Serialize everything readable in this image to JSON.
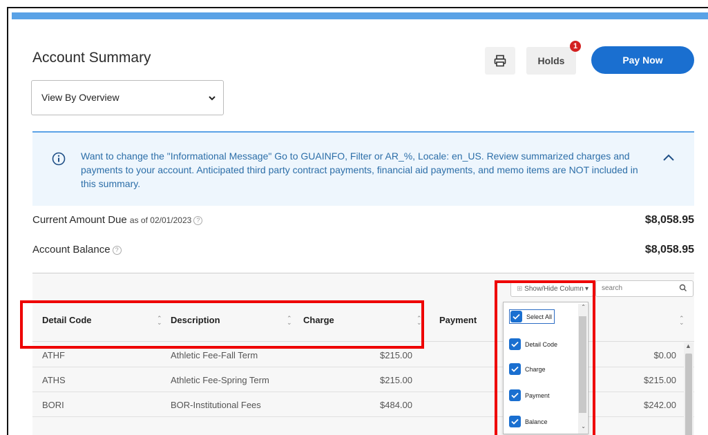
{
  "page": {
    "title": "Account Summary"
  },
  "toolbar": {
    "print_icon": "printer-icon",
    "holds_label": "Holds",
    "holds_count": "1",
    "pay_label": "Pay Now"
  },
  "view_select": {
    "value": "View By Overview"
  },
  "info": {
    "text": "Want to change the \"Informational Message\" Go to GUAINFO, Filter or AR_%, Locale: en_US. Review summarized charges and payments to your account. Anticipated third party contract payments, financial aid payments, and memo items are NOT included in this summary."
  },
  "summary": {
    "due_label": "Current Amount Due",
    "due_date": "as of 02/01/2023",
    "due_amount": "$8,058.95",
    "balance_label": "Account Balance",
    "balance_amount": "$8,058.95"
  },
  "table_controls": {
    "column_toggle": "Show/Hide Column",
    "search_placeholder": "search"
  },
  "columns": [
    "Detail Code",
    "Description",
    "Charge",
    "Payment",
    "Balance"
  ],
  "rows": [
    {
      "code": "ATHF",
      "description": "Athletic Fee-Fall Term",
      "charge": "$215.00",
      "balance": "$0.00"
    },
    {
      "code": "ATHS",
      "description": "Athletic Fee-Spring Term",
      "charge": "$215.00",
      "balance": "$215.00"
    },
    {
      "code": "BORI",
      "description": "BOR-Institutional Fees",
      "charge": "$484.00",
      "balance": "$242.00"
    }
  ],
  "column_menu": {
    "items": [
      {
        "label": "Select All",
        "checked": true
      },
      {
        "label": "Detail Code",
        "checked": true
      },
      {
        "label": "Charge",
        "checked": true
      },
      {
        "label": "Payment",
        "checked": true
      },
      {
        "label": "Balance",
        "checked": true
      }
    ]
  },
  "colors": {
    "accent": "#1a6fd0",
    "info_bg": "#eef6fd",
    "highlight": "#ee0000"
  }
}
